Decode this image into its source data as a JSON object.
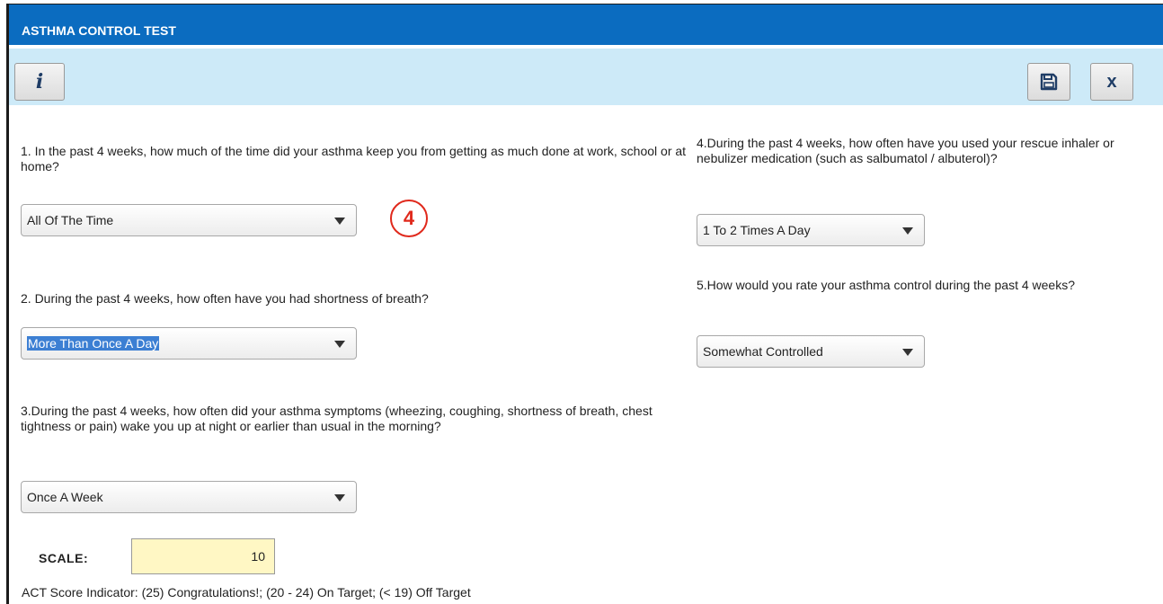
{
  "window": {
    "title": "ASTHMA CONTROL TEST"
  },
  "toolbar": {
    "info_icon": "info-icon",
    "save_icon": "save-icon",
    "close_label": "x"
  },
  "questions": [
    {
      "text": "1. In the past 4 weeks, how much of the time did your asthma keep you from getting as much done at work, school or at home?",
      "selected": "All Of The Time"
    },
    {
      "text": "2. During the past 4 weeks, how often have you had shortness of breath?",
      "selected": "More Than Once A Day"
    },
    {
      "text": "3.During the past 4 weeks, how often did your asthma symptoms (wheezing, coughing, shortness of breath, chest tightness or pain) wake you up at night or earlier than usual in the morning?",
      "selected": "Once A Week"
    },
    {
      "text": "4.During the past 4 weeks, how often have you used your rescue inhaler or nebulizer medication (such as salbumatol / albuterol)?",
      "selected": "1 To 2 Times A Day"
    },
    {
      "text": "5.How would you rate your asthma control during the past 4 weeks?",
      "selected": "Somewhat Controlled"
    }
  ],
  "annotation_marker": "4",
  "scale": {
    "label": "SCALE:",
    "value": "10"
  },
  "indicator_text": "ACT Score Indicator: (25) Congratulations!; (20 - 24) On Target; (< 19) Off Target",
  "colors": {
    "titlebar": "#0b6cc0",
    "toolbar": "#cdeaf8",
    "scale_bg": "#fff7c4",
    "marker": "#e0291c"
  }
}
